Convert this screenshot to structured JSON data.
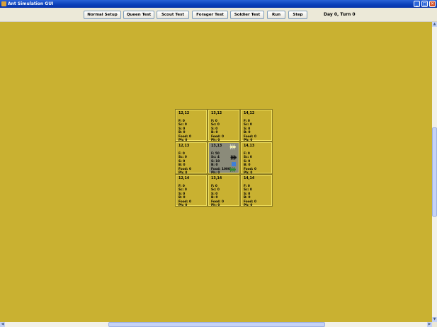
{
  "window": {
    "title": "Ant Simulation GUI",
    "controls": {
      "minimize": "_",
      "maximize": "□",
      "close": "✕"
    }
  },
  "toolbar": {
    "buttons": [
      "Normal Setup",
      "Queen Test",
      "Scout Test",
      "Forager Test",
      "Soldier Test",
      "Run",
      "Step"
    ],
    "status": "Day 0, Turn 0"
  },
  "colors": {
    "canvas": "#c9b131",
    "colony_cell": "#8b8b7a",
    "cell_border": "#f0e060"
  },
  "grid": {
    "cells": [
      {
        "coord": "12,12",
        "f": "F: 0",
        "sc": "Sc: 0",
        "s": "S: 0",
        "b": "B: 0",
        "food": "Food: 0",
        "ph": "Ph: 0"
      },
      {
        "coord": "13,12",
        "f": "F: 0",
        "sc": "Sc: 0",
        "s": "S: 0",
        "b": "B: 0",
        "food": "Food: 0",
        "ph": "Ph: 0"
      },
      {
        "coord": "14,12",
        "f": "F: 0",
        "sc": "Sc: 0",
        "s": "S: 0",
        "b": "B: 0",
        "food": "Food: 0",
        "ph": "Ph: 0"
      },
      {
        "coord": "12,13",
        "f": "F: 0",
        "sc": "Sc: 0",
        "s": "S: 0",
        "b": "B: 0",
        "food": "Food: 0",
        "ph": "Ph: 0"
      },
      {
        "coord": "13,13",
        "f": "F: 50",
        "sc": "Sc: 4",
        "s": "S: 10",
        "b": "B: 0",
        "food": "Food: 1000",
        "ph": "Ph: 0"
      },
      {
        "coord": "14,13",
        "f": "F: 0",
        "sc": "Sc: 0",
        "s": "S: 0",
        "b": "B: 0",
        "food": "Food: 0",
        "ph": "Ph: 0"
      },
      {
        "coord": "12,14",
        "f": "F: 0",
        "sc": "Sc: 0",
        "s": "S: 0",
        "b": "B: 0",
        "food": "Food: 0",
        "ph": "Ph: 0"
      },
      {
        "coord": "13,14",
        "f": "F: 0",
        "sc": "Sc: 0",
        "s": "S: 0",
        "b": "B: 0",
        "food": "Food: 0",
        "ph": "Ph: 0"
      },
      {
        "coord": "14,14",
        "f": "F: 0",
        "sc": "Sc: 0",
        "s": "S: 0",
        "b": "B: 0",
        "food": "Food: 0",
        "ph": "Ph: 0"
      }
    ],
    "ant_icons": [
      "scout-ant-icon",
      "soldier-ant-icon",
      "queen-ant-icon",
      "forager-ant-icon"
    ]
  }
}
